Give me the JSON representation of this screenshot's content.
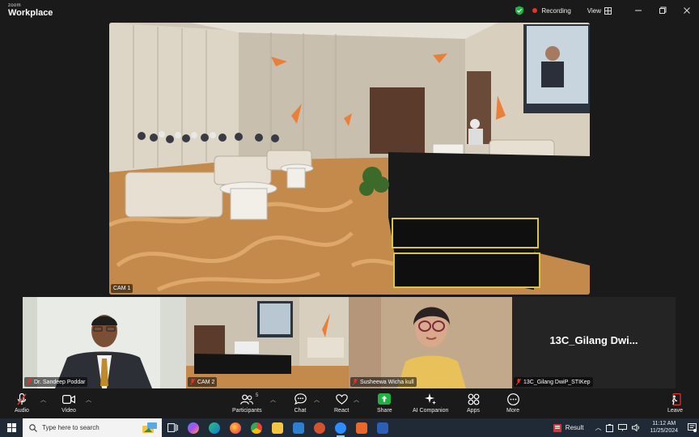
{
  "app": {
    "logo_top": "zoom",
    "logo_bottom": "Workplace"
  },
  "titlebar": {
    "recording_label": "Recording",
    "view_label": "View"
  },
  "main_video": {
    "label": "CAM 1"
  },
  "gallery": [
    {
      "name": "Dr. Sandeep Poddar"
    },
    {
      "name": "CAM 2"
    },
    {
      "name": "Susheewa Wicha kull"
    },
    {
      "name": "13C_Gilang DwiP_STIKep",
      "display_name": "13C_Gilang Dwi..."
    }
  ],
  "controls": {
    "audio": "Audio",
    "video": "Video",
    "participants": "Participants",
    "participants_count": "5",
    "chat": "Chat",
    "react": "React",
    "share": "Share",
    "ai_companion": "AI Companion",
    "apps": "Apps",
    "more": "More",
    "leave": "Leave"
  },
  "taskbar": {
    "search_placeholder": "Type here to search",
    "tray_text": "Result",
    "time": "11:12 AM",
    "date": "11/25/2024"
  },
  "colors": {
    "accent_green": "#1fb141",
    "leave_red": "#e5322d",
    "share_green": "#1fb141"
  }
}
